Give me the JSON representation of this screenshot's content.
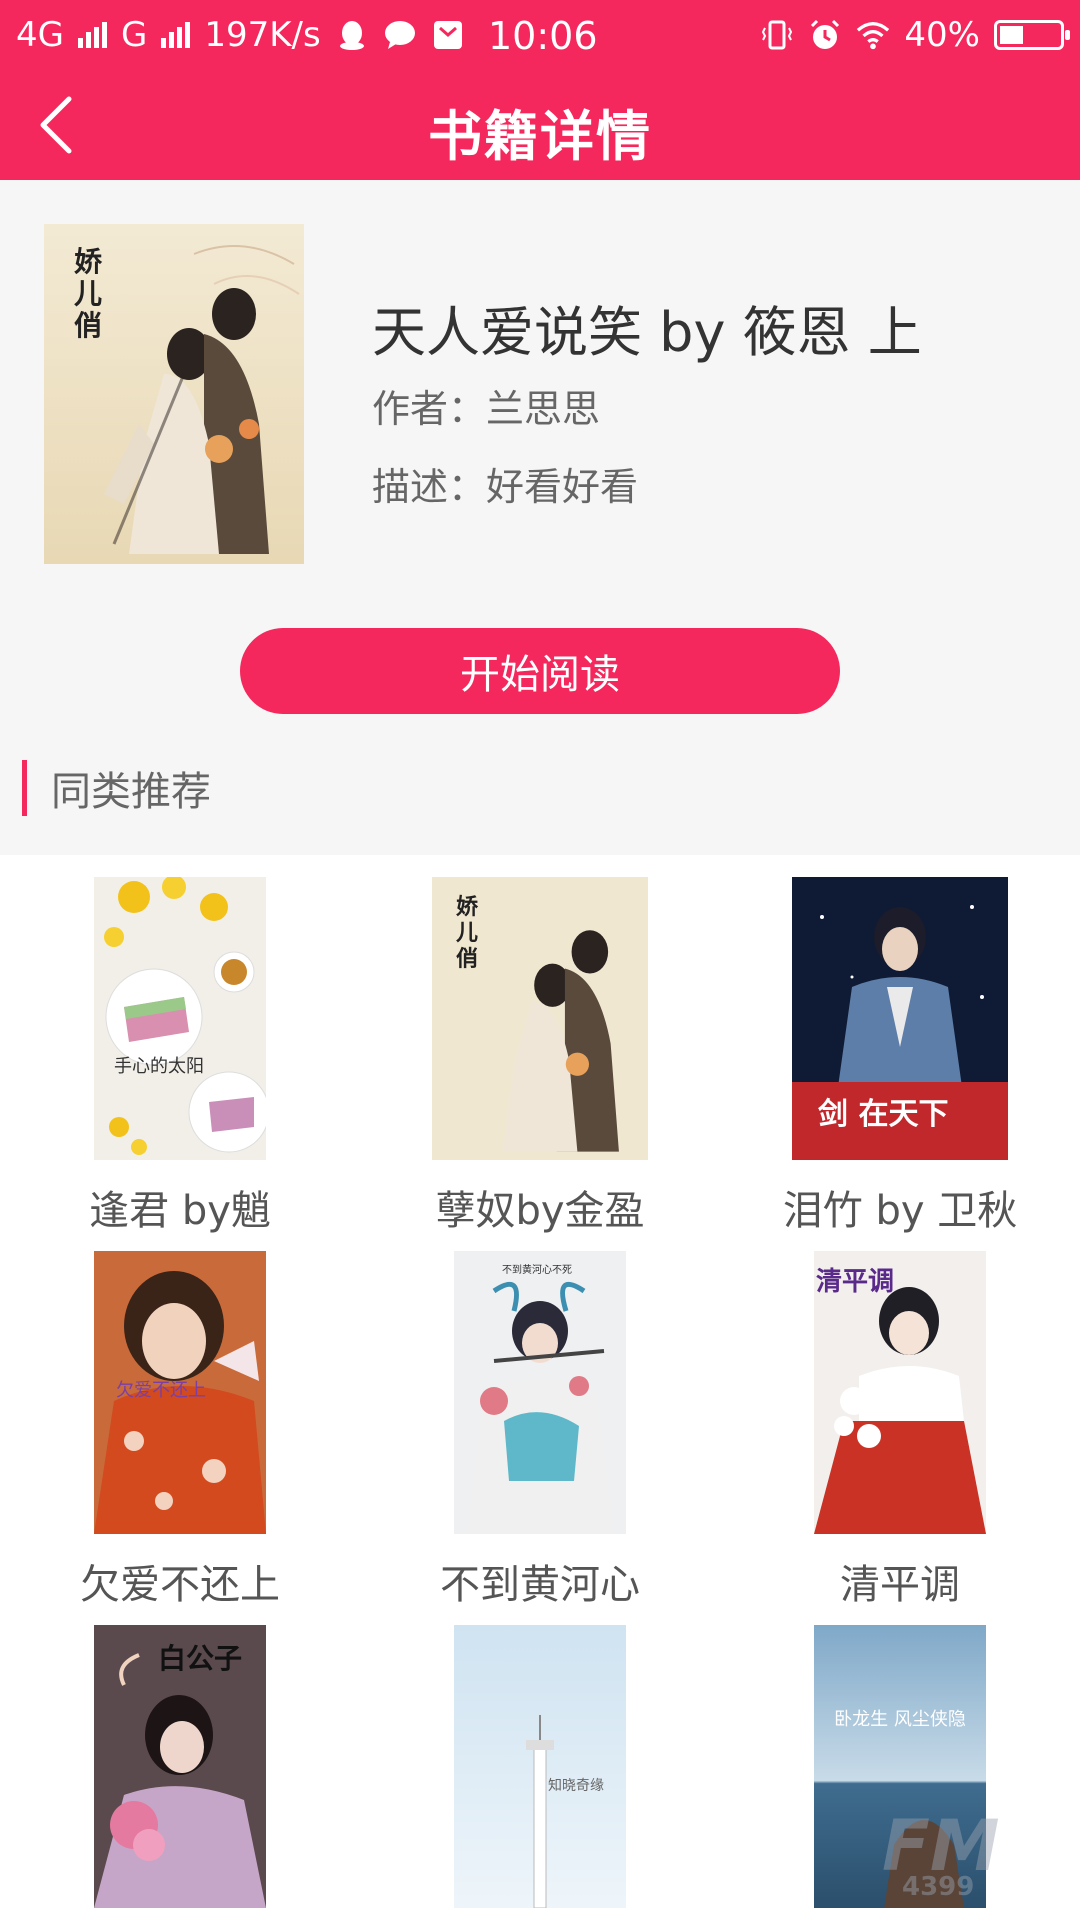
{
  "status_bar": {
    "network1": "4G",
    "network2": "G",
    "speed": "197K/s",
    "time": "10:06",
    "battery": "40%",
    "battery_level": 0.4,
    "icons": [
      "qq-icon",
      "chat-bubble-icon",
      "mail-icon",
      "vibrate-icon",
      "alarm-icon",
      "wifi-icon"
    ]
  },
  "header": {
    "title": "书籍详情",
    "back_icon": "back-chevron-icon"
  },
  "book": {
    "title": "天人爱说笑 by 筱恩 上",
    "author": "作者：兰思思",
    "description": "描述：好看好看",
    "cover_text": "娇儿俏"
  },
  "actions": {
    "read_label": "开始阅读"
  },
  "section": {
    "title": "同类推荐"
  },
  "colors": {
    "accent": "#f5285d",
    "background": "#f6f6f6"
  },
  "recommendations": [
    {
      "title": "逢君 by魈",
      "cover_text": "手心的太阳"
    },
    {
      "title": "孽奴by金盈",
      "cover_text": "娇儿俏"
    },
    {
      "title": "泪竹 by 卫秋",
      "cover_text": "剑 在天下"
    },
    {
      "title": "欠爱不还上",
      "cover_text": "欠爱不还上"
    },
    {
      "title": "不到黄河心",
      "cover_text": "不到黄河心不死"
    },
    {
      "title": "清平调",
      "cover_text": "清平调"
    },
    {
      "title": "",
      "cover_text": "白公子"
    },
    {
      "title": "",
      "cover_text": "知晓奇缘"
    },
    {
      "title": "",
      "cover_text": "卧龙生 风尘侠隐"
    }
  ],
  "watermark": "4399"
}
